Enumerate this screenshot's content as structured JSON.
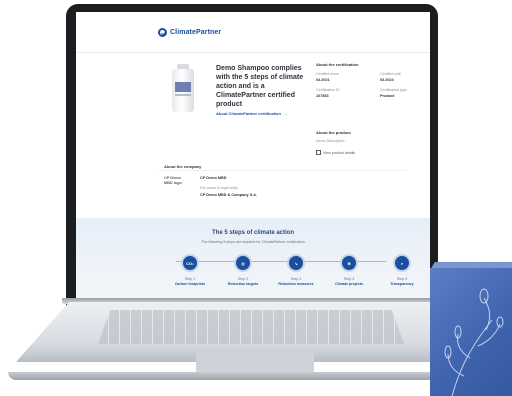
{
  "header": {
    "brand": "ClimatePartner"
  },
  "product": {
    "headline": "Demo Shampoo complies with the 5 steps of climate action and is a ClimatePartner certified product",
    "about_link": "About ClimatePartner certification",
    "link_arrow": "→"
  },
  "certification": {
    "heading": "About the certification",
    "fields": [
      {
        "label": "Certified since",
        "value": "04.2021"
      },
      {
        "label": "Certified until",
        "value": "03.2024"
      },
      {
        "label": "Certification ID",
        "value": "167863"
      },
      {
        "label": "Certification type",
        "value": "Product"
      }
    ]
  },
  "about_product": {
    "heading": "About the product",
    "description": "Demo Description",
    "view_link": "View product details"
  },
  "company": {
    "heading": "About the company",
    "logo_text": "CP Demo\nMBD logo",
    "name": "CP Demo MBD",
    "legal_label": "Full name of legal entity",
    "legal_value": "CP Demo MBD & Company S.A."
  },
  "steps": {
    "title": "The 5 steps of climate action",
    "subtitle": "The following 5 steps are required for ClimatePartner certification",
    "items": [
      {
        "num": "Step 1",
        "desc": "Carbon footprints",
        "icon": "co2-icon",
        "glyph": "CO₂"
      },
      {
        "num": "Step 2",
        "desc": "Reduction targets",
        "icon": "target-icon",
        "glyph": "◎"
      },
      {
        "num": "Step 3",
        "desc": "Reduction measures",
        "icon": "reduction-icon",
        "glyph": "↘"
      },
      {
        "num": "Step 4",
        "desc": "Climate projects",
        "icon": "globe-icon",
        "glyph": "⊕"
      },
      {
        "num": "Step 5",
        "desc": "Transparency",
        "icon": "magnifier-icon",
        "glyph": "⌕"
      }
    ]
  },
  "colors": {
    "brand_blue": "#1a4fa0",
    "box_blue": "#3f63ad"
  }
}
